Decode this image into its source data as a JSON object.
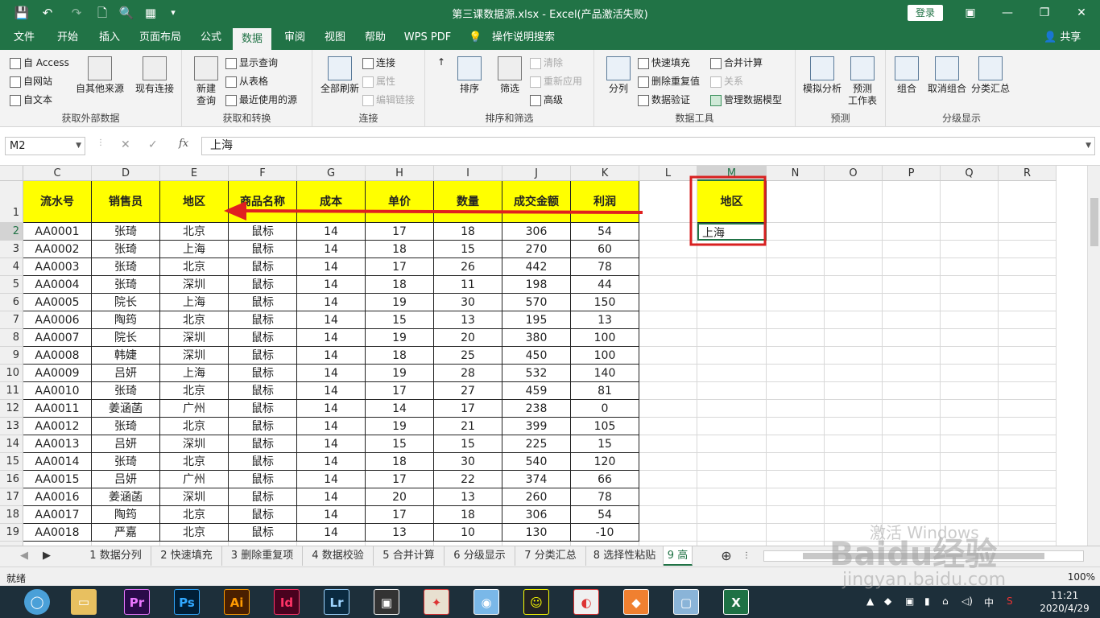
{
  "titlebar": {
    "title": "第三课数据源.xlsx  -  Excel(产品激活失败)",
    "login": "登录",
    "qa_save": "💾",
    "qa_undo": "↶",
    "qa_redo": "↷",
    "qa_new": "🗋",
    "qa_preview": "🔍",
    "qa_form": "▦",
    "qa_more": "▾",
    "minimize": "—",
    "restore": "❐",
    "close": "✕",
    "ribbon_display": "▣"
  },
  "tabs": [
    "文件",
    "开始",
    "插入",
    "页面布局",
    "公式",
    "数据",
    "审阅",
    "视图",
    "帮助",
    "WPS PDF",
    "操作说明搜索"
  ],
  "share": "共享",
  "ribbon": {
    "get_external": {
      "label": "获取外部数据",
      "access": "自 Access",
      "web": "自网站",
      "text": "自文本",
      "other": "自其他来源",
      "existing": "现有连接"
    },
    "get_transform": {
      "label": "获取和转换",
      "new_query": "新建\n查询",
      "show_query": "显示查询",
      "from_table": "从表格",
      "recent": "最近使用的源"
    },
    "connections": {
      "label": "连接",
      "refresh": "全部刷新",
      "conn": "连接",
      "props": "属性",
      "edit_links": "编辑链接"
    },
    "sort_filter": {
      "label": "排序和筛选",
      "sort": "排序",
      "filter": "筛选",
      "clear": "清除",
      "reapply": "重新应用",
      "advanced": "高级"
    },
    "data_tools": {
      "label": "数据工具",
      "split": "分列",
      "flash": "快速填充",
      "remove_dup": "删除重复值",
      "validate": "数据验证",
      "consolidate": "合并计算",
      "relations": "关系",
      "model": "管理数据模型"
    },
    "forecast": {
      "label": "预测",
      "whatif": "模拟分析",
      "sheet": "预测\n工作表"
    },
    "outline": {
      "label": "分级显示",
      "group": "组合",
      "ungroup": "取消组合",
      "subtotal": "分类汇总"
    }
  },
  "formulabar": {
    "namebox": "M2",
    "value": "上海",
    "fx": "fx"
  },
  "columns": [
    "C",
    "D",
    "E",
    "F",
    "G",
    "H",
    "I",
    "J",
    "K",
    "L",
    "M",
    "N",
    "O",
    "P",
    "Q",
    "R"
  ],
  "headers": [
    "流水号",
    "销售员",
    "地区",
    "商品名称",
    "成本",
    "单价",
    "数量",
    "成交金额",
    "利润"
  ],
  "rows": [
    [
      "AA0001",
      "张琦",
      "北京",
      "鼠标",
      "14",
      "17",
      "18",
      "306",
      "54"
    ],
    [
      "AA0002",
      "张琦",
      "上海",
      "鼠标",
      "14",
      "18",
      "15",
      "270",
      "60"
    ],
    [
      "AA0003",
      "张琦",
      "北京",
      "鼠标",
      "14",
      "17",
      "26",
      "442",
      "78"
    ],
    [
      "AA0004",
      "张琦",
      "深圳",
      "鼠标",
      "14",
      "18",
      "11",
      "198",
      "44"
    ],
    [
      "AA0005",
      "院长",
      "上海",
      "鼠标",
      "14",
      "19",
      "30",
      "570",
      "150"
    ],
    [
      "AA0006",
      "陶筠",
      "北京",
      "鼠标",
      "14",
      "15",
      "13",
      "195",
      "13"
    ],
    [
      "AA0007",
      "院长",
      "深圳",
      "鼠标",
      "14",
      "19",
      "20",
      "380",
      "100"
    ],
    [
      "AA0008",
      "韩婕",
      "深圳",
      "鼠标",
      "14",
      "18",
      "25",
      "450",
      "100"
    ],
    [
      "AA0009",
      "吕妍",
      "上海",
      "鼠标",
      "14",
      "19",
      "28",
      "532",
      "140"
    ],
    [
      "AA0010",
      "张琦",
      "北京",
      "鼠标",
      "14",
      "17",
      "27",
      "459",
      "81"
    ],
    [
      "AA0011",
      "姜涵菡",
      "广州",
      "鼠标",
      "14",
      "14",
      "17",
      "238",
      "0"
    ],
    [
      "AA0012",
      "张琦",
      "北京",
      "鼠标",
      "14",
      "19",
      "21",
      "399",
      "105"
    ],
    [
      "AA0013",
      "吕妍",
      "深圳",
      "鼠标",
      "14",
      "15",
      "15",
      "225",
      "15"
    ],
    [
      "AA0014",
      "张琦",
      "北京",
      "鼠标",
      "14",
      "18",
      "30",
      "540",
      "120"
    ],
    [
      "AA0015",
      "吕妍",
      "广州",
      "鼠标",
      "14",
      "17",
      "22",
      "374",
      "66"
    ],
    [
      "AA0016",
      "姜涵菡",
      "深圳",
      "鼠标",
      "14",
      "20",
      "13",
      "260",
      "78"
    ],
    [
      "AA0017",
      "陶筠",
      "北京",
      "鼠标",
      "14",
      "17",
      "18",
      "306",
      "54"
    ],
    [
      "AA0018",
      "严嘉",
      "北京",
      "鼠标",
      "14",
      "13",
      "10",
      "130",
      "-10"
    ]
  ],
  "criteria": {
    "header": "地区",
    "value": "上海"
  },
  "sheets": [
    "1 数据分列",
    "2 快速填充",
    "3 删除重复项",
    "4 数据校验",
    "5 合并计算",
    "6 分级显示",
    "7 分类汇总",
    "8 选择性粘贴",
    "9 高"
  ],
  "status": {
    "ready": "就绪",
    "zoom": "100%"
  },
  "taskbar": {
    "apps": [
      "Pr",
      "Ps",
      "Ai",
      "Id",
      "Lr",
      "▣",
      "✦",
      "◉",
      "☺",
      "◐",
      "◆",
      "▢",
      "X"
    ],
    "time": "11:21",
    "date": "2020/4/29",
    "ime": "中"
  },
  "watermark": {
    "line1": "激活 Windows",
    "line2": "Baidu经验",
    "line3": "jingyan.baidu.com"
  },
  "colors": {
    "accent": "#217346",
    "header_fill": "#ffff00",
    "highlight": "#e02020"
  }
}
